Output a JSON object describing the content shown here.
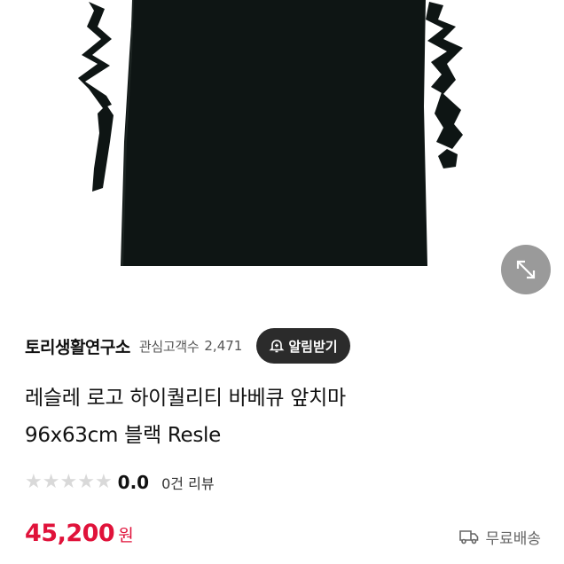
{
  "seller": {
    "name": "토리생활연구소",
    "follower_label": "관심고객수",
    "follower_count": "2,471",
    "alert_button_label": "알림받기"
  },
  "product": {
    "title_line1": "레슬레 로고 하이퀄리티 바베큐 앞치마",
    "title_line2": "96x63cm 블랙 Resle",
    "image_icon": "apron-image",
    "color_black": "#0e1514"
  },
  "rating": {
    "score": "0.0",
    "stars_filled": 0,
    "stars_total": 5,
    "review_count_label": "0건 리뷰"
  },
  "price": {
    "value": "45,200",
    "unit": "원",
    "color": "#e0123a"
  },
  "shipping": {
    "icon": "truck-icon",
    "label": "무료배송"
  },
  "zoom": {
    "icon": "expand-arrows-icon"
  }
}
